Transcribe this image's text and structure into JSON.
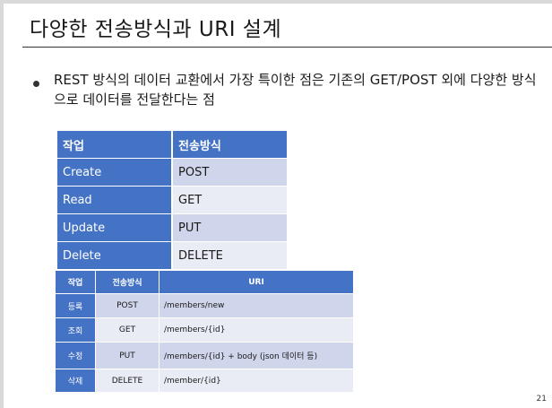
{
  "slide": {
    "title": "다양한 전송방식과 URI 설계",
    "bullet": "REST 방식의 데이터 교환에서 가장 특이한 점은 기존의 GET/POST 외에 다양한 방식으로 데이터를 전달한다는 점",
    "page_number": "21"
  },
  "table1": {
    "headers": [
      "작업",
      "전송방식"
    ],
    "rows": [
      [
        "Create",
        "POST"
      ],
      [
        "Read",
        "GET"
      ],
      [
        "Update",
        "PUT"
      ],
      [
        "Delete",
        "DELETE"
      ]
    ]
  },
  "table2": {
    "headers": [
      "작업",
      "전송방식",
      "URI"
    ],
    "rows": [
      [
        "등록",
        "POST",
        "/members/new"
      ],
      [
        "조회",
        "GET",
        "/members/{id}"
      ],
      [
        "수정",
        "PUT",
        "/members/{id} + body (json 데이터 등)"
      ],
      [
        "삭제",
        "DELETE",
        "/member/{id}"
      ]
    ]
  },
  "colors": {
    "header_blue": "#4472c4",
    "row_dark": "#cfd5ea",
    "row_light": "#e9ebf5"
  }
}
